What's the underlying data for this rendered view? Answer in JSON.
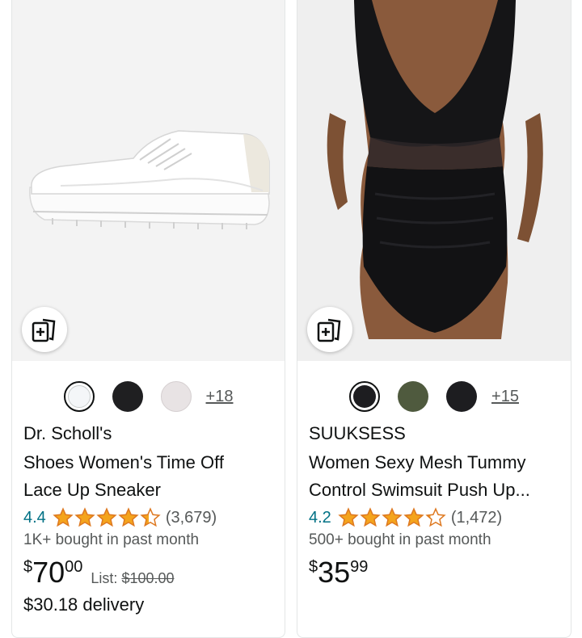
{
  "products": [
    {
      "brand": "Dr. Scholl's",
      "title": "Shoes Women's Time Off Lace Up Sneaker",
      "rating": "4.4",
      "rating_value": 4.4,
      "review_count": "(3,679)",
      "bought": "1K+ bought in past month",
      "price_symbol": "$",
      "price_whole": "70",
      "price_fraction": "00",
      "list_label": "List: ",
      "list_price": "$100.00",
      "delivery": "$30.18 delivery",
      "more_colors": "+18",
      "swatch_colors": [
        "#f4f6f8",
        "#1f1f21",
        "#e8e3e4"
      ],
      "image_icon": "white-sneaker-image",
      "compare_icon": "compare-cards-icon"
    },
    {
      "brand": "SUUKSESS",
      "title": "Women Sexy Mesh Tummy Control Swimsuit Push Up...",
      "rating": "4.2",
      "rating_value": 4.2,
      "review_count": "(1,472)",
      "bought": "500+ bought in past month",
      "price_symbol": "$",
      "price_whole": "35",
      "price_fraction": "99",
      "more_colors": "+15",
      "swatch_colors": [
        "#1d1d20",
        "#4f5a3e",
        "#1d1d20"
      ],
      "image_icon": "black-swimsuit-image",
      "compare_icon": "compare-cards-icon"
    }
  ],
  "colors": {
    "star": "#F4A41C",
    "link": "#007185",
    "muted": "#565959"
  }
}
